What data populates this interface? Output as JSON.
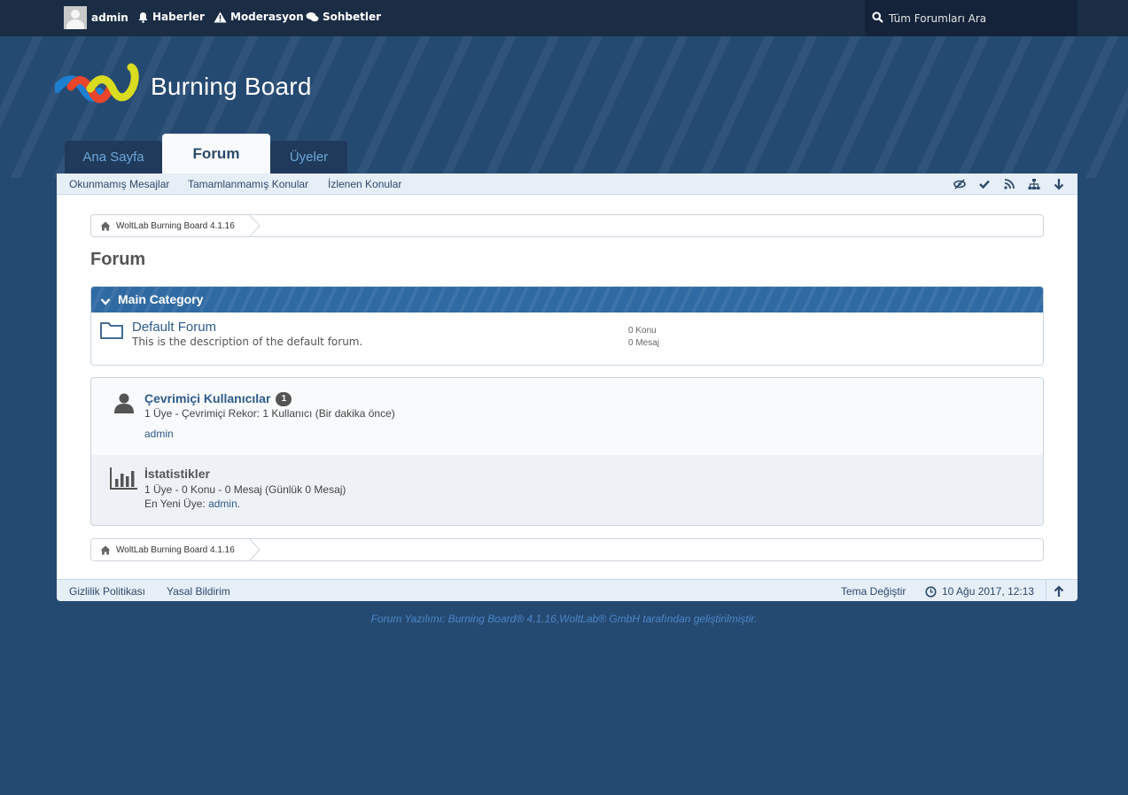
{
  "topbar": {
    "username": "admin",
    "nav": [
      "Haberler",
      "Moderasyon",
      "Sohbetler"
    ],
    "search_placeholder": "Tüm Forumları Ara"
  },
  "header": {
    "logo_text": "Burning Board"
  },
  "tabs": [
    {
      "label": "Ana Sayfa",
      "active": false
    },
    {
      "label": "Forum",
      "active": true
    },
    {
      "label": "Üyeler",
      "active": false
    }
  ],
  "subnav": {
    "links": [
      "Okunmamış Mesajlar",
      "Tamamlanmamış Konular",
      "İzlenen Konular"
    ],
    "icons": [
      "eye-slash-icon",
      "check-icon",
      "rss-icon",
      "sitemap-icon",
      "arrow-down-icon"
    ]
  },
  "breadcrumb": {
    "item": "WoltLab Burning Board 4.1.16"
  },
  "page": {
    "title": "Forum"
  },
  "category": {
    "title": "Main Category",
    "forum": {
      "title": "Default Forum",
      "description": "This is the description of the default forum.",
      "topics": "0 Konu",
      "posts": "0 Mesaj"
    }
  },
  "online": {
    "title": "Çevrimiçi Kullanıcılar",
    "count": "1",
    "summary": "1 Üye - Çevrimiçi Rekor: 1 Kullanıcı (Bir dakika önce)",
    "user": "admin"
  },
  "stats": {
    "title": "İstatistikler",
    "summary": "1 Üye - 0 Konu - 0 Mesaj (Günlük 0 Mesaj)",
    "newest_label": "En Yeni Üye:",
    "newest_user": "admin",
    "newest_suffix": "."
  },
  "footer": {
    "links": [
      "Gizlilik Politikası",
      "Yasal Bildirim"
    ],
    "theme": "Tema Değiştir",
    "datetime": "10 Ağu 2017, 12:13"
  },
  "copyright": "Forum Yazılımı: Burning Board® 4.1.16,WoltLab® GmbH tarafından geliştirilmiştir.",
  "colors": {
    "background": "#254a72",
    "topbar": "#1a2d44",
    "category_header": "#2f6aa3",
    "link": "#2e5a8a"
  }
}
